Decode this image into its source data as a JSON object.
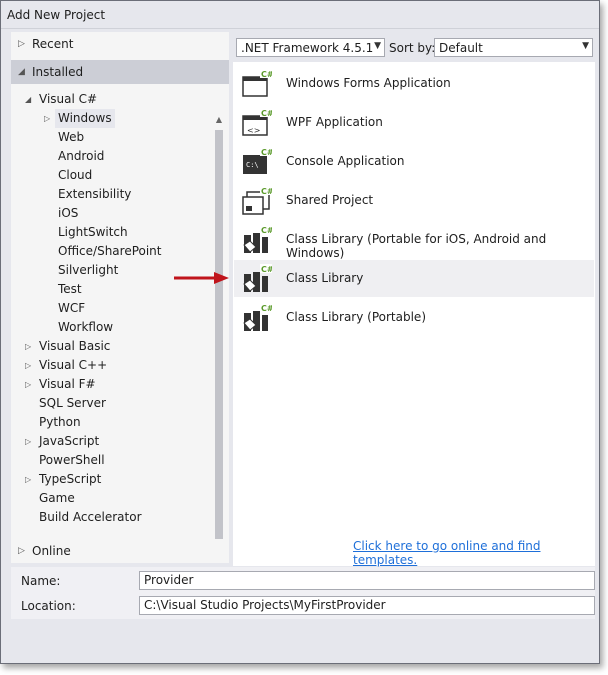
{
  "window": {
    "title": "Add New Project"
  },
  "left": {
    "recent_label": "Recent",
    "installed_label": "Installed",
    "online_label": "Online",
    "tree": [
      {
        "label": "Visual C#",
        "level": 0,
        "state": "expanded"
      },
      {
        "label": "Windows",
        "level": 1,
        "state": "collapsed",
        "selected": true
      },
      {
        "label": "Web",
        "level": 1,
        "state": "none"
      },
      {
        "label": "Android",
        "level": 1,
        "state": "none"
      },
      {
        "label": "Cloud",
        "level": 1,
        "state": "none"
      },
      {
        "label": "Extensibility",
        "level": 1,
        "state": "none"
      },
      {
        "label": "iOS",
        "level": 1,
        "state": "none"
      },
      {
        "label": "LightSwitch",
        "level": 1,
        "state": "none"
      },
      {
        "label": "Office/SharePoint",
        "level": 1,
        "state": "none"
      },
      {
        "label": "Silverlight",
        "level": 1,
        "state": "none"
      },
      {
        "label": "Test",
        "level": 1,
        "state": "none"
      },
      {
        "label": "WCF",
        "level": 1,
        "state": "none"
      },
      {
        "label": "Workflow",
        "level": 1,
        "state": "none"
      },
      {
        "label": "Visual Basic",
        "level": 0,
        "state": "collapsed"
      },
      {
        "label": "Visual C++",
        "level": 0,
        "state": "collapsed"
      },
      {
        "label": "Visual F#",
        "level": 0,
        "state": "collapsed"
      },
      {
        "label": "SQL Server",
        "level": 0,
        "state": "none"
      },
      {
        "label": "Python",
        "level": 0,
        "state": "none"
      },
      {
        "label": "JavaScript",
        "level": 0,
        "state": "collapsed"
      },
      {
        "label": "PowerShell",
        "level": 0,
        "state": "none"
      },
      {
        "label": "TypeScript",
        "level": 0,
        "state": "collapsed"
      },
      {
        "label": "Game",
        "level": 0,
        "state": "none"
      },
      {
        "label": "Build Accelerator",
        "level": 0,
        "state": "none"
      }
    ]
  },
  "toolbar": {
    "framework_value": ".NET Framework 4.5.1",
    "sort_label": "Sort by:",
    "sort_value": "Default"
  },
  "templates": [
    {
      "name": "Windows Forms Application",
      "icon": "winforms-csharp-icon",
      "selected": false
    },
    {
      "name": "WPF Application",
      "icon": "wpf-csharp-icon",
      "selected": false
    },
    {
      "name": "Console Application",
      "icon": "console-csharp-icon",
      "selected": false
    },
    {
      "name": "Shared Project",
      "icon": "shared-project-csharp-icon",
      "selected": false
    },
    {
      "name": "Class Library (Portable for iOS, Android and Windows)",
      "icon": "class-library-csharp-icon",
      "selected": false
    },
    {
      "name": "Class Library",
      "icon": "class-library-csharp-icon",
      "selected": true
    },
    {
      "name": "Class Library (Portable)",
      "icon": "class-library-csharp-icon",
      "selected": false
    }
  ],
  "online_link": "Click here to go online and find templates.",
  "form": {
    "name_label": "Name:",
    "name_value": "Provider",
    "location_label": "Location:",
    "location_value": "C:\\Visual Studio Projects\\MyFirstProvider"
  },
  "colors": {
    "annotation_arrow": "#c0141b",
    "csharp_badge": "#5a9a2a",
    "link": "#1e6fd9"
  }
}
